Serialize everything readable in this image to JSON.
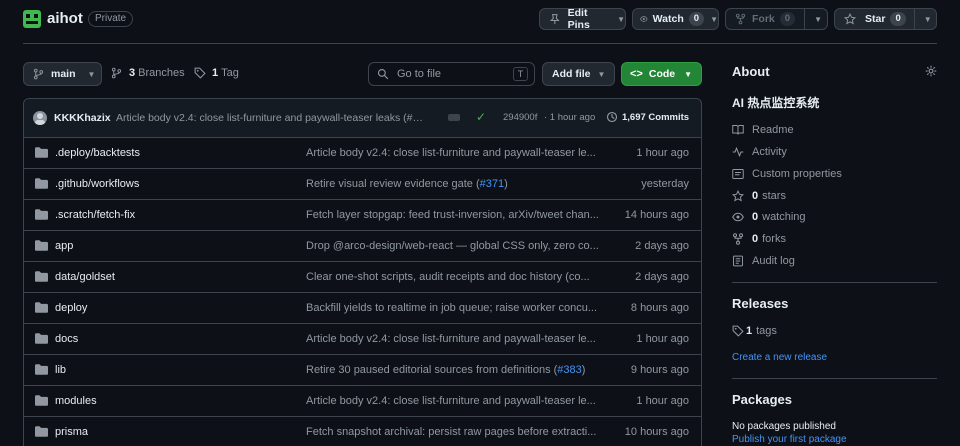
{
  "repo": {
    "name": "aihot",
    "visibility": "Private"
  },
  "header_actions": {
    "edit_pins": "Edit Pins",
    "watch": "Watch",
    "watch_count": "0",
    "fork": "Fork",
    "fork_count": "0",
    "star": "Star",
    "star_count": "0"
  },
  "toolbar": {
    "branch": "main",
    "branches_count": "3",
    "branches_label": "Branches",
    "tags_count": "1",
    "tags_label": "Tag",
    "search_placeholder": "Go to file",
    "search_shortcut": "T",
    "add_file": "Add file",
    "code": "Code"
  },
  "latest_commit": {
    "author": "KKKKhazix",
    "message": "Article body v2.4: close list-furniture and paywall-teaser leaks (#…",
    "hash": "294900f",
    "time": "· 1 hour ago",
    "commits_count": "1,697 Commits"
  },
  "files": [
    {
      "name": ".deploy/backtests",
      "message": "Article body v2.4: close list-furniture and paywall-teaser le...",
      "time": "1 hour ago"
    },
    {
      "name": ".github/workflows",
      "message": "Retire visual review evidence gate (",
      "link": "#371",
      "tail": ")",
      "time": "yesterday"
    },
    {
      "name": ".scratch/fetch-fix",
      "message": "Fetch layer stopgap: feed trust-inversion, arXiv/tweet chan...",
      "time": "14 hours ago"
    },
    {
      "name": "app",
      "message": "Drop @arco-design/web-react — global CSS only, zero co...",
      "time": "2 days ago"
    },
    {
      "name": "data/goldset",
      "message": "Clear one-shot scripts, audit receipts and doc history (co...",
      "time": "2 days ago"
    },
    {
      "name": "deploy",
      "message": "Backfill yields to realtime in job queue; raise worker concu...",
      "time": "8 hours ago"
    },
    {
      "name": "docs",
      "message": "Article body v2.4: close list-furniture and paywall-teaser le...",
      "time": "1 hour ago"
    },
    {
      "name": "lib",
      "message": "Retire 30 paused editorial sources from definitions (",
      "link": "#383",
      "tail": ")",
      "time": "9 hours ago"
    },
    {
      "name": "modules",
      "message": "Article body v2.4: close list-furniture and paywall-teaser le...",
      "time": "1 hour ago"
    },
    {
      "name": "prisma",
      "message": "Fetch snapshot archival: persist raw pages before extracti...",
      "time": "10 hours ago"
    }
  ],
  "about": {
    "title": "About",
    "description": "AI 热点监控系统",
    "readme": "Readme",
    "activity": "Activity",
    "custom_properties": "Custom properties",
    "stars_count": "0",
    "stars_label": "stars",
    "watching_count": "0",
    "watching_label": "watching",
    "forks_count": "0",
    "forks_label": "forks",
    "audit_log": "Audit log"
  },
  "releases": {
    "title": "Releases",
    "tags_count": "1",
    "tags_label": "tags",
    "create_link": "Create a new release"
  },
  "packages": {
    "title": "Packages",
    "empty": "No packages published",
    "publish_link": "Publish your first package"
  },
  "colors": {
    "green": "#238636",
    "link": "#4493f8",
    "bg": "#0d1117",
    "border": "#3d444d"
  }
}
